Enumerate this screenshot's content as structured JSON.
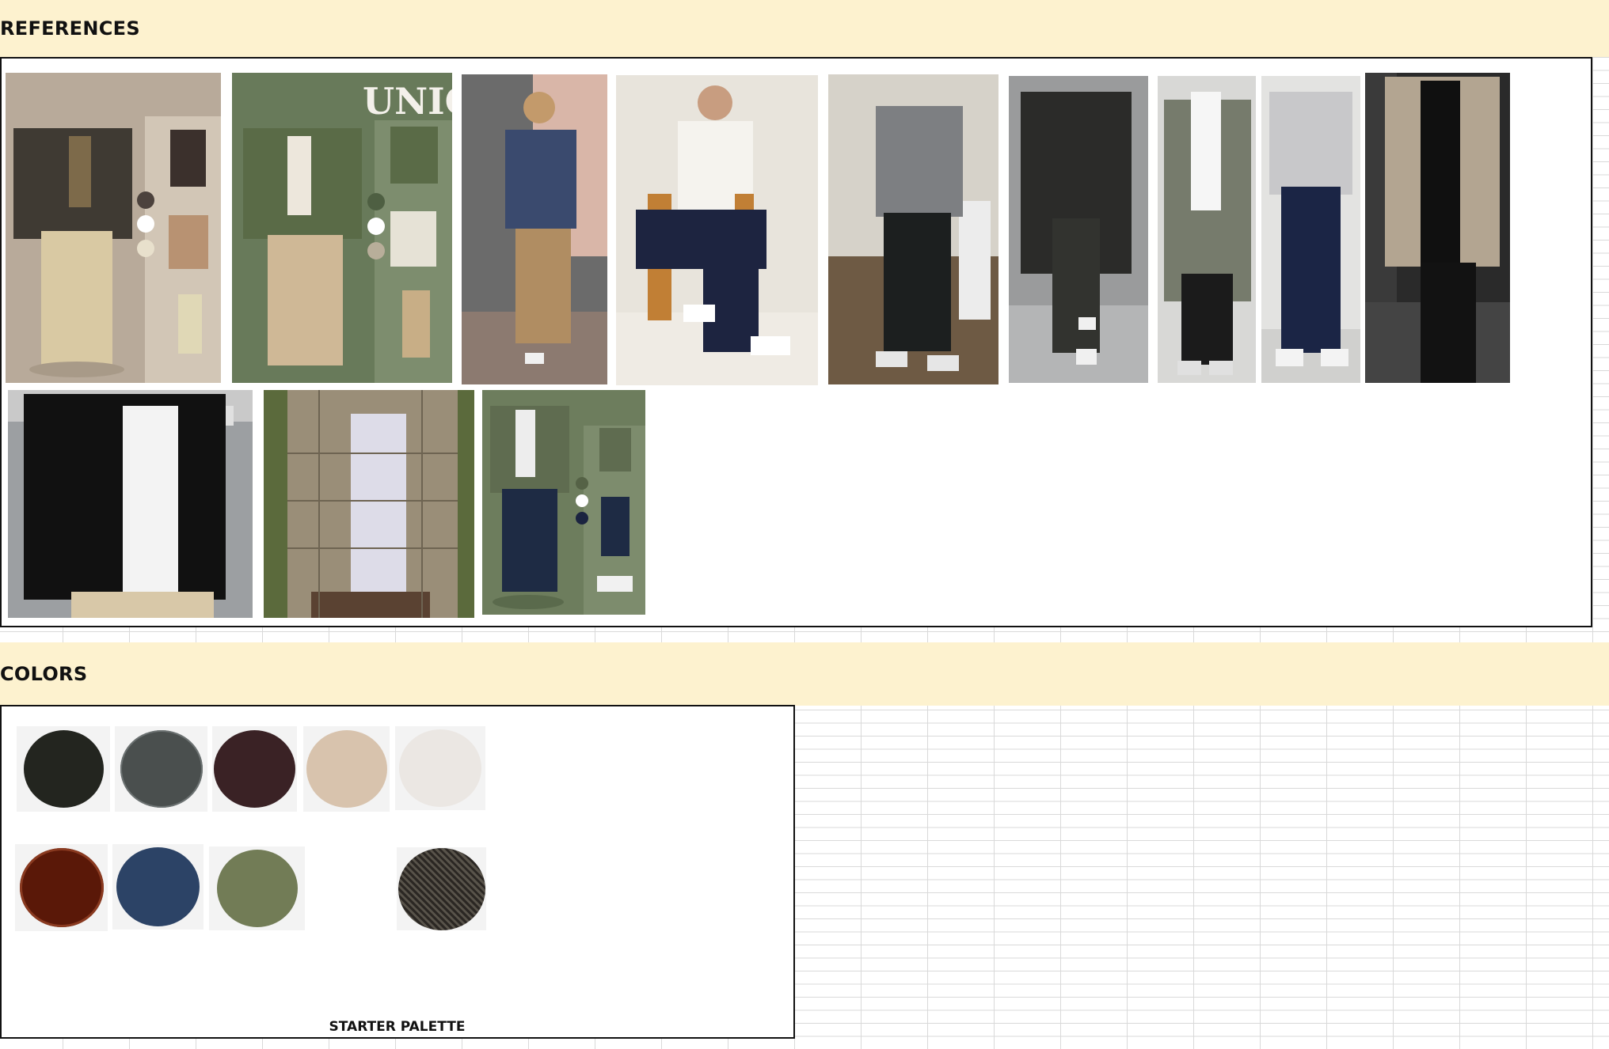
{
  "sections": {
    "references_title": "REFERENCES",
    "colors_title": "COLORS"
  },
  "references": {
    "row1": [
      {
        "name": "ref-outfit-brown-shirt-jacket",
        "overlay_text": ""
      },
      {
        "name": "ref-outfit-olive-jacket-uniqlo",
        "overlay_text": "UNIQL"
      },
      {
        "name": "ref-outfit-navy-hoodie",
        "overlay_text": ""
      },
      {
        "name": "ref-outfit-white-sweater-chair",
        "overlay_text": ""
      },
      {
        "name": "ref-outfit-grey-sweater",
        "overlay_text": ""
      },
      {
        "name": "ref-outfit-black-hoodie-coat",
        "overlay_text": ""
      },
      {
        "name": "ref-outfit-olive-overcoat",
        "overlay_text": ""
      },
      {
        "name": "ref-outfit-grey-sweatshirt-navy-pants",
        "overlay_text": ""
      },
      {
        "name": "ref-outfit-beige-overshirt",
        "overlay_text": ""
      }
    ],
    "row2": [
      {
        "name": "ref-outfit-black-jacket",
        "overlay_text": ""
      },
      {
        "name": "ref-outfit-plaid-overshirt",
        "overlay_text": ""
      },
      {
        "name": "ref-outfit-olive-jacket-jeans",
        "overlay_text": ""
      }
    ]
  },
  "colors": {
    "palette_label": "STARTER PALETTE",
    "swatches_row1": [
      "#23251f",
      "#4a4f4e",
      "#3a2225",
      "#d8c3ad",
      "#ebe7e3"
    ],
    "swatches_row2": [
      "#5a1808",
      "#2c4366",
      "#727c56",
      "herringbone"
    ]
  }
}
